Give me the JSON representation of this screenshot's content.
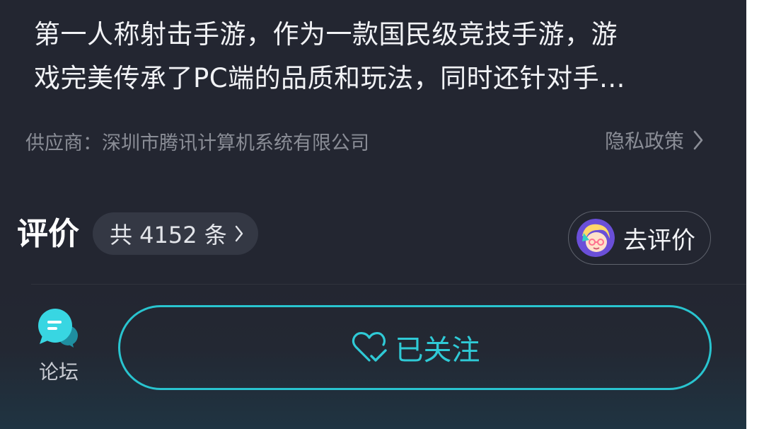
{
  "description": {
    "top_partial_line": "",
    "lines": [
      "第一人称射击手游，作为一款国民级竞技手游，游",
      "戏完美传承了PC端的品质和玩法，同时还针对手..."
    ]
  },
  "supplier": "供应商：深圳市腾讯计算机系统有限公司",
  "privacy": {
    "label": "隐私政策",
    "icon": "chevron-right-icon"
  },
  "reviews": {
    "title": "评价",
    "count_label": "共 4152 条",
    "count_icon": "chevron-right-icon",
    "write_label": "去评价",
    "avatar": "cartoon-avatar"
  },
  "bottom_bar": {
    "forum_label": "论坛",
    "forum_icon": "chat-bubble-icon",
    "follow_label": "已关注",
    "follow_icon": "heart-check-icon"
  },
  "colors": {
    "background": "#232631",
    "accent": "#29c4cf",
    "muted_text": "#8a8d96"
  }
}
